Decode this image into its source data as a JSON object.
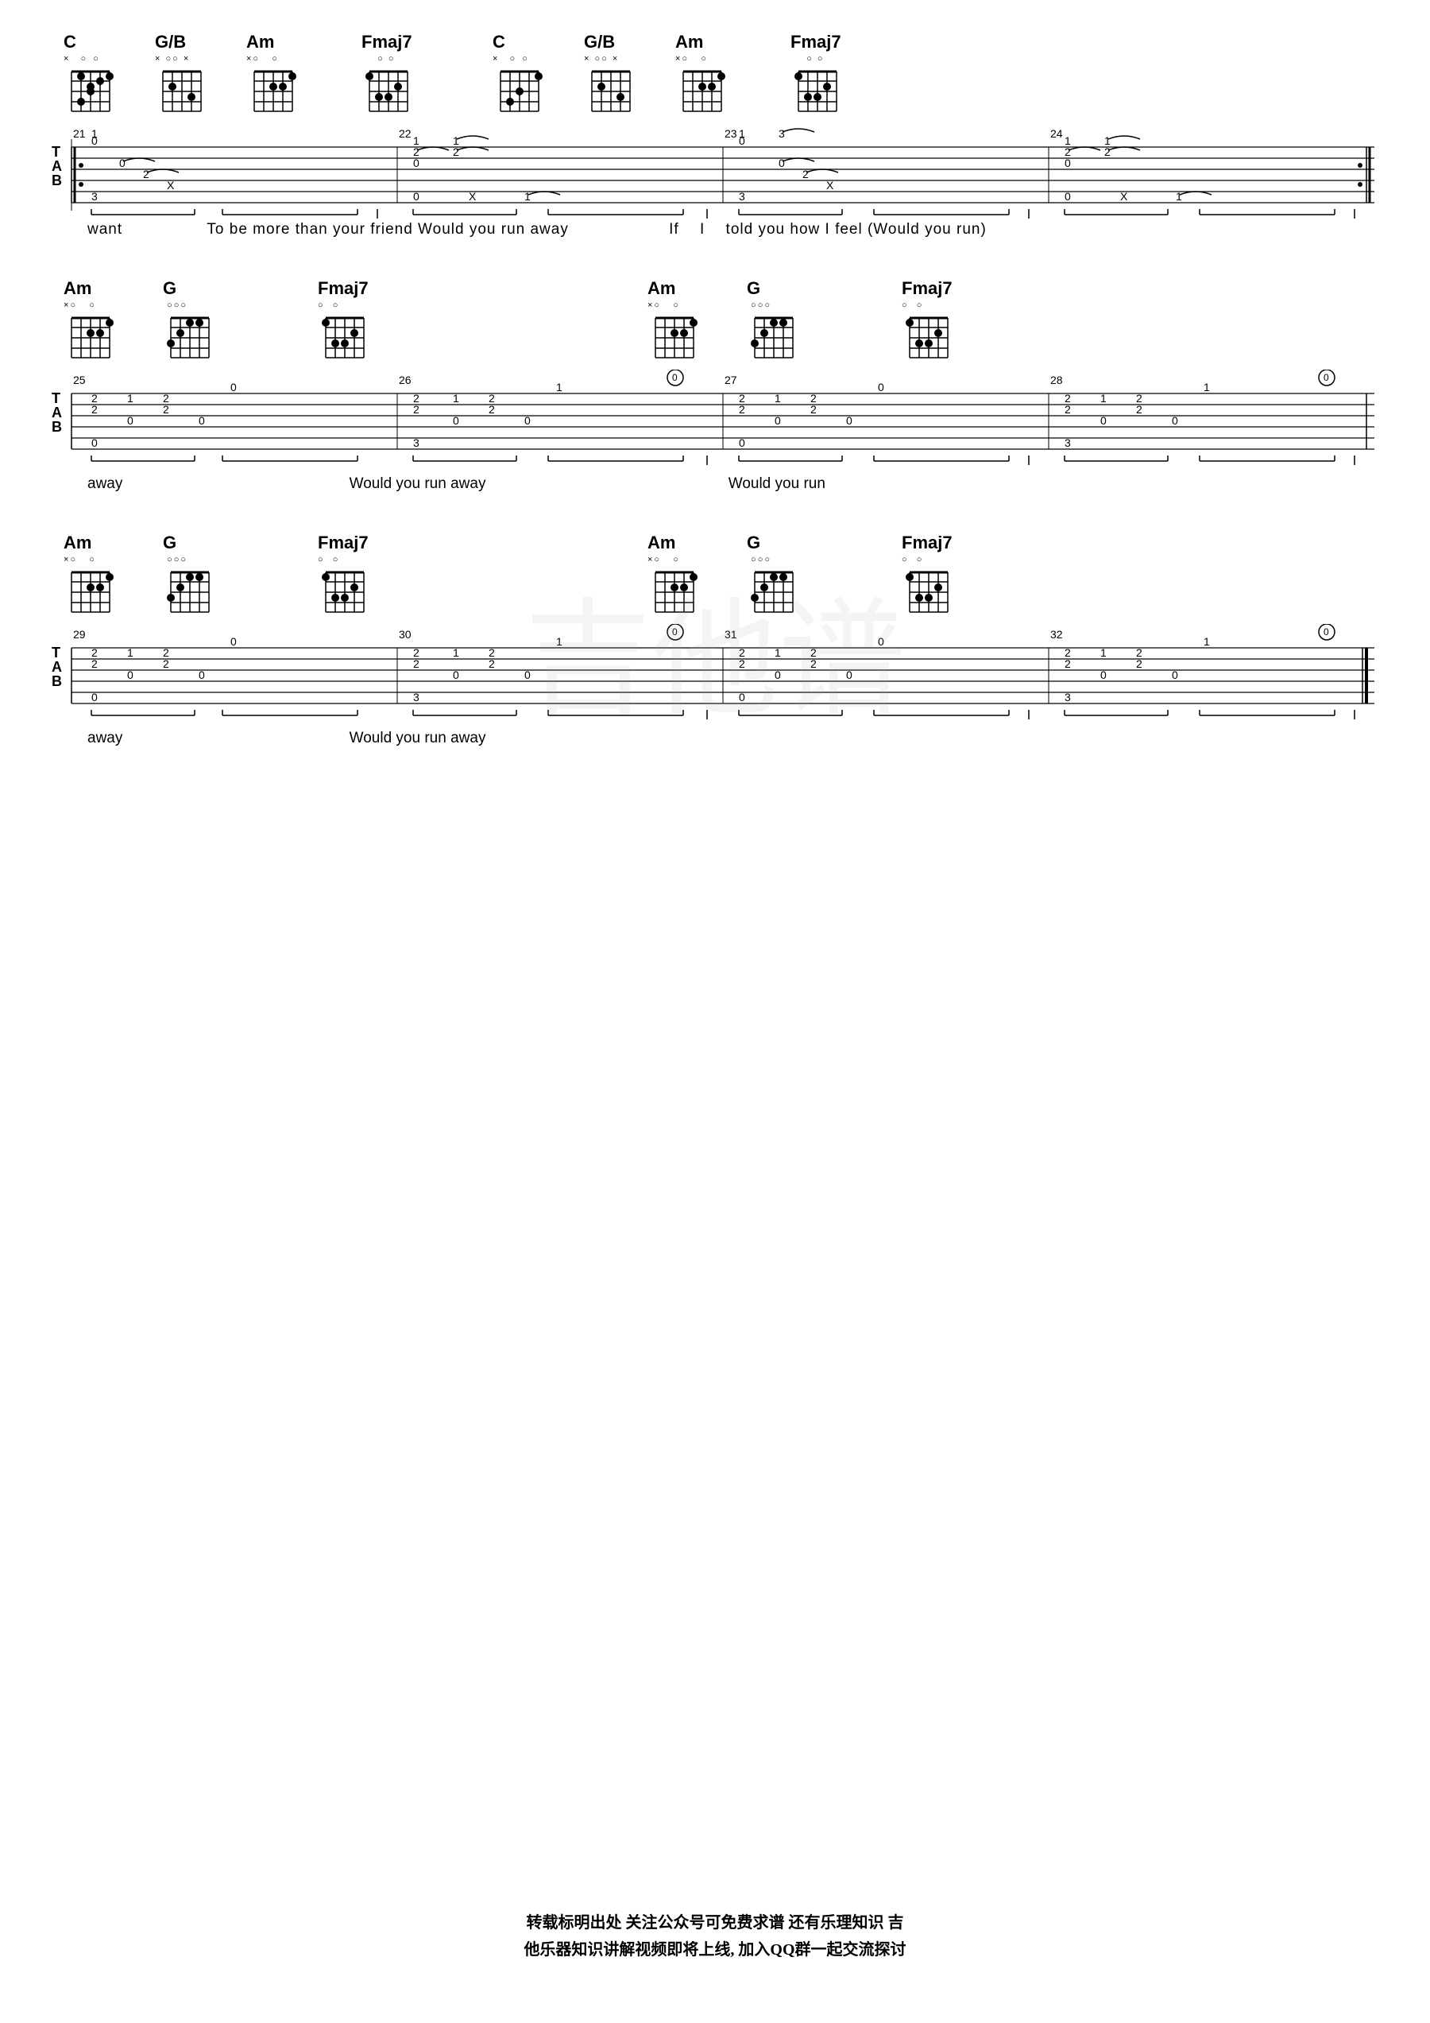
{
  "sections": [
    {
      "id": "section1",
      "chords": [
        {
          "name": "C",
          "mutes": "x  o o",
          "frets": [
            null,
            3,
            2,
            0,
            1,
            0
          ],
          "diagram_id": "C"
        },
        {
          "name": "G/B",
          "mutes": "x oo x",
          "frets": [
            null,
            2,
            0,
            0,
            3,
            null
          ],
          "diagram_id": "GB"
        },
        {
          "name": "Am",
          "mutes": "xo   o",
          "frets": [
            null,
            0,
            2,
            2,
            1,
            0
          ],
          "diagram_id": "Am"
        },
        {
          "name": "Fmaj7",
          "mutes": "    o o",
          "frets": [
            1,
            3,
            3,
            2,
            1,
            0
          ],
          "diagram_id": "Fmaj7"
        },
        {
          "name": "C",
          "mutes": "x  o o",
          "frets": [
            null,
            3,
            2,
            0,
            1,
            0
          ],
          "diagram_id": "C2"
        },
        {
          "name": "G/B",
          "mutes": "x oo x",
          "frets": [
            null,
            2,
            0,
            0,
            3,
            null
          ],
          "diagram_id": "GB2"
        },
        {
          "name": "Am",
          "mutes": "xo   o",
          "frets": [
            null,
            0,
            2,
            2,
            1,
            0
          ],
          "diagram_id": "Am2"
        },
        {
          "name": "Fmaj7",
          "mutes": "    o o",
          "frets": [
            1,
            3,
            3,
            2,
            1,
            0
          ],
          "diagram_id": "Fmaj72"
        }
      ],
      "measures": [
        "21",
        "22",
        "23",
        "24"
      ],
      "lyrics": "want     To be more than your friend Would you run away          If   I   told you how I feel (Would you run)"
    },
    {
      "id": "section2",
      "chords": [
        {
          "name": "Am",
          "mutes": "xo   o",
          "diagram_id": "Am3"
        },
        {
          "name": "G",
          "mutes": " ooo",
          "diagram_id": "G1"
        },
        {
          "name": "Fmaj7",
          "mutes": "o  o",
          "diagram_id": "Fmaj73"
        },
        {
          "name": "Am",
          "mutes": "xo   o",
          "diagram_id": "Am4"
        },
        {
          "name": "G",
          "mutes": " ooo",
          "diagram_id": "G2"
        },
        {
          "name": "Fmaj7",
          "mutes": "o  o",
          "diagram_id": "Fmaj74"
        }
      ],
      "measures": [
        "25",
        "26",
        "27",
        "28"
      ],
      "lyrics": "away                              Would you run away                         Would you run"
    },
    {
      "id": "section3",
      "chords": [
        {
          "name": "Am",
          "mutes": "xo   o",
          "diagram_id": "Am5"
        },
        {
          "name": "G",
          "mutes": " ooo",
          "diagram_id": "G3"
        },
        {
          "name": "Fmaj7",
          "mutes": "o  o",
          "diagram_id": "Fmaj75"
        },
        {
          "name": "Am",
          "mutes": "xo   o",
          "diagram_id": "Am6"
        },
        {
          "name": "G",
          "mutes": " ooo",
          "diagram_id": "G4"
        },
        {
          "name": "Fmaj7",
          "mutes": "o  o",
          "diagram_id": "Fmaj76"
        }
      ],
      "measures": [
        "29",
        "30",
        "31",
        "32"
      ],
      "lyrics": "away                              Would you run away"
    }
  ],
  "footer": {
    "line1": "转载标明出处  关注公众号可免费求谱  还有乐理知识   吉",
    "line2": "他乐器知识讲解视频即将上线, 加入QQ群一起交流探讨"
  },
  "watermark": "吉他谱"
}
